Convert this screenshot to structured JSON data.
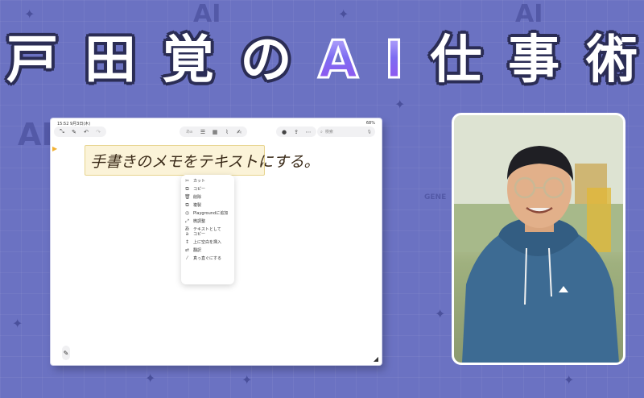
{
  "title": {
    "chars": [
      "戸",
      "田",
      "覚",
      "の",
      "A",
      "I",
      "仕",
      "事",
      "術"
    ]
  },
  "ipad": {
    "status_left": "15:52  9月3日(木)",
    "status_right": "68%",
    "toolbar_text_btn": "あa",
    "search_placeholder": "検索",
    "handwriting": "手書きのメモをテキストにする。",
    "context_menu": [
      {
        "icon": "scissors-icon",
        "glyph": "✂",
        "label": "カット"
      },
      {
        "icon": "copy-icon",
        "glyph": "⧉",
        "label": "コピー"
      },
      {
        "icon": "trash-icon",
        "glyph": "🗑",
        "label": "削除"
      },
      {
        "icon": "duplicate-icon",
        "glyph": "⧉",
        "label": "複製"
      },
      {
        "icon": "playground-icon",
        "glyph": "◎",
        "label": "Playgroundに追加"
      },
      {
        "icon": "straighten-icon",
        "glyph": "⤢",
        "label": "微調整"
      },
      {
        "icon": "text-copy-icon",
        "glyph": "あa",
        "label": "テキストとして\nコピー"
      },
      {
        "icon": "insert-space-icon",
        "glyph": "↕",
        "label": "上に空白を挿入"
      },
      {
        "icon": "translate-icon",
        "glyph": "⇄",
        "label": "翻訳"
      },
      {
        "icon": "straighten-line-icon",
        "glyph": "⁄",
        "label": "真っ直ぐにする"
      }
    ]
  },
  "colors": {
    "background": "#6b72c2",
    "title_fill": "#ffffff",
    "ai_gradient_start": "#c6b8ff",
    "ai_gradient_end": "#9a4df0"
  }
}
